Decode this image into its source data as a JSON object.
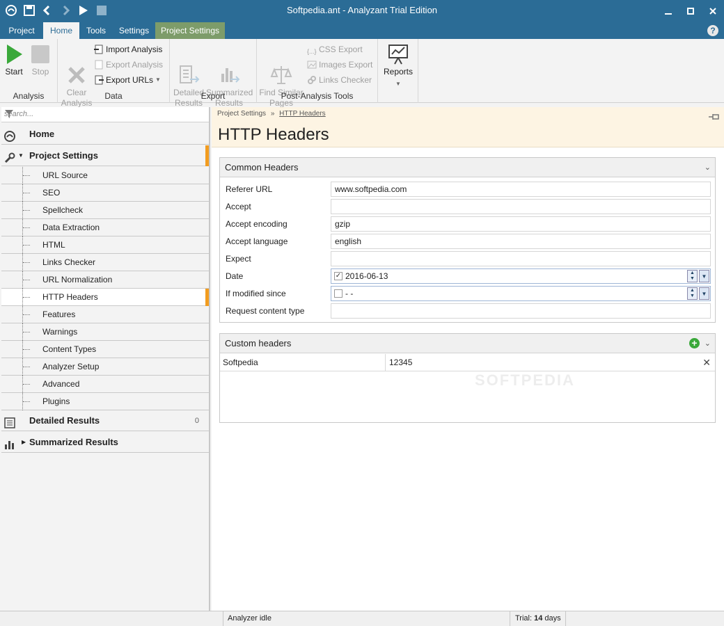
{
  "window": {
    "title": "Softpedia.ant - Analyzant Trial Edition"
  },
  "tabs": [
    {
      "label": "Project"
    },
    {
      "label": "Home"
    },
    {
      "label": "Tools"
    },
    {
      "label": "Settings"
    },
    {
      "label": "Project Settings"
    }
  ],
  "help_label": "?",
  "ribbon": {
    "analysis": {
      "label": "Analysis",
      "start": "Start",
      "stop": "Stop"
    },
    "data": {
      "label": "Data",
      "clear": "Clear\nAnalysis",
      "import": "Import Analysis",
      "export_analysis": "Export Analysis",
      "export_urls": "Export URLs"
    },
    "export": {
      "label": "Export",
      "detailed": "Detailed\nResults",
      "summarized": "Summarized\nResults"
    },
    "post": {
      "label": "Post-Analysis Tools",
      "find_similar": "Find Similar\nPages",
      "css_export": "CSS Export",
      "images_export": "Images Export",
      "links_checker": "Links Checker"
    },
    "reports": {
      "label": "Reports"
    }
  },
  "sidebar": {
    "search_placeholder": "search...",
    "home": "Home",
    "project_settings": "Project Settings",
    "items": [
      "URL Source",
      "SEO",
      "Spellcheck",
      "Data Extraction",
      "HTML",
      "Links Checker",
      "URL Normalization",
      "HTTP Headers",
      "Features",
      "Warnings",
      "Content Types",
      "Analyzer Setup",
      "Advanced",
      "Plugins"
    ],
    "selected_item": "HTTP Headers",
    "detailed_results": "Detailed Results",
    "detailed_count": "0",
    "summarized_results": "Summarized Results"
  },
  "main": {
    "breadcrumb_root": "Project Settings",
    "breadcrumb_sep": "»",
    "breadcrumb_current": "HTTP Headers",
    "title": "HTTP Headers",
    "common": {
      "title": "Common Headers",
      "fields": [
        {
          "label": "Referer URL",
          "value": "www.softpedia.com"
        },
        {
          "label": "Accept",
          "value": ""
        },
        {
          "label": "Accept encoding",
          "value": "gzip"
        },
        {
          "label": "Accept language",
          "value": "english"
        },
        {
          "label": "Expect",
          "value": ""
        },
        {
          "label": "Date",
          "value": "2016-06-13",
          "checked": true
        },
        {
          "label": "If modified since",
          "value": "-  -",
          "checked": false
        },
        {
          "label": "Request content type",
          "value": ""
        }
      ]
    },
    "custom": {
      "title": "Custom headers",
      "rows": [
        {
          "name": "Softpedia",
          "value": "12345"
        }
      ]
    }
  },
  "status": {
    "state": "Analyzer idle",
    "trial_prefix": "Trial:",
    "trial_days": "14",
    "trial_suffix": "days"
  },
  "watermark": "SOFTPEDIA",
  "colors": {
    "titlebar": "#2b6c96",
    "accent": "#f29c1f",
    "context_tab": "#7d9c6a",
    "start_green": "#3aa83a"
  }
}
